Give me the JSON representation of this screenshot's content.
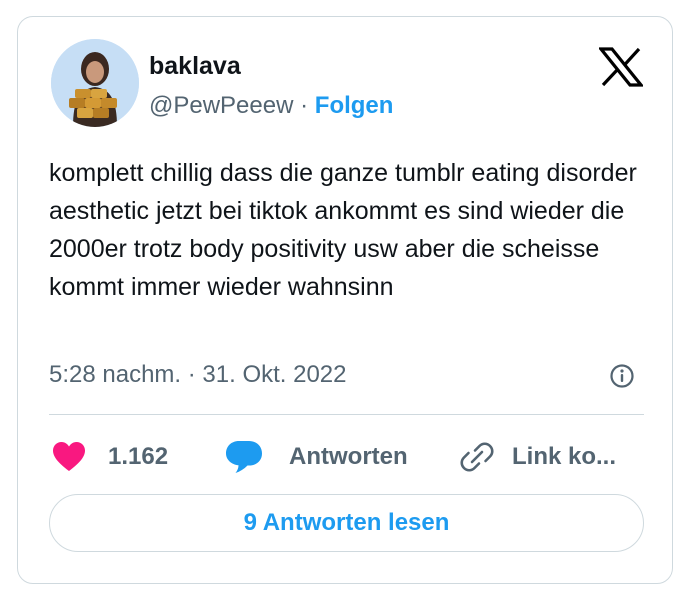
{
  "author": {
    "display_name": "baklava",
    "handle": "@PewPeeew",
    "separator": "·",
    "follow_label": "Folgen"
  },
  "tweet": {
    "text": "komplett chillig dass die ganze tumblr eating disorder aesthetic jetzt bei tiktok ankommt es sind wieder die 2000er trotz body positivity usw aber die scheisse kommt immer wieder wahnsinn",
    "timestamp": "5:28 nachm. · 31. Okt. 2022"
  },
  "actions": {
    "like_count": "1.162",
    "reply_label": "Antworten",
    "link_label": "Link ko..."
  },
  "read_replies_label": "9 Antworten lesen",
  "colors": {
    "accent": "#1d9bf0",
    "like": "#f91880",
    "text": "#0f1419",
    "muted": "#536471",
    "border": "#cfd9de"
  },
  "icons": {
    "brand": "x-logo-icon",
    "info": "info-icon",
    "like": "heart-icon",
    "reply": "speech-bubble-icon",
    "link": "link-icon"
  }
}
